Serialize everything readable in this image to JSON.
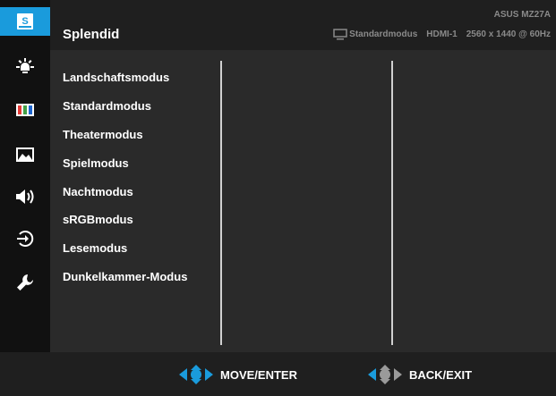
{
  "sidebar": {
    "items": [
      {
        "id": "splendid",
        "icon": "splendid-s-icon",
        "glyph": "S",
        "active": true
      },
      {
        "id": "blue-light-filter",
        "icon": "blue-light-filter-icon",
        "active": false
      },
      {
        "id": "color",
        "icon": "color-bars-icon",
        "active": false
      },
      {
        "id": "image",
        "icon": "image-landscape-icon",
        "active": false
      },
      {
        "id": "sound",
        "icon": "speaker-icon",
        "active": false
      },
      {
        "id": "input-select",
        "icon": "input-select-icon",
        "active": false
      },
      {
        "id": "system-setup",
        "icon": "wrench-icon",
        "active": false
      }
    ]
  },
  "header": {
    "title": "Splendid",
    "model": "ASUS MZ27A",
    "status": {
      "mode_icon": "monitor-icon",
      "mode": "Standardmodus",
      "input": "HDMI-1",
      "resolution": "2560 x 1440 @ 60Hz"
    }
  },
  "menu": {
    "items": [
      "Landschaftsmodus",
      "Standardmodus",
      "Theatermodus",
      "Spielmodus",
      "Nachtmodus",
      "sRGBmodus",
      "Lesemodus",
      "Dunkelkammer-Modus"
    ]
  },
  "footer": {
    "move_icon": "four-way-navigation-icon",
    "move_label": "MOVE/ENTER",
    "back_icon": "back-navigation-icon",
    "back_label": "BACK/EXIT"
  },
  "colors": {
    "accent": "#1a9bdc",
    "background": "#1f1f1f",
    "panel": "#2a2a2a",
    "text": "#ffffff",
    "muted_text": "#8a8a8a"
  }
}
